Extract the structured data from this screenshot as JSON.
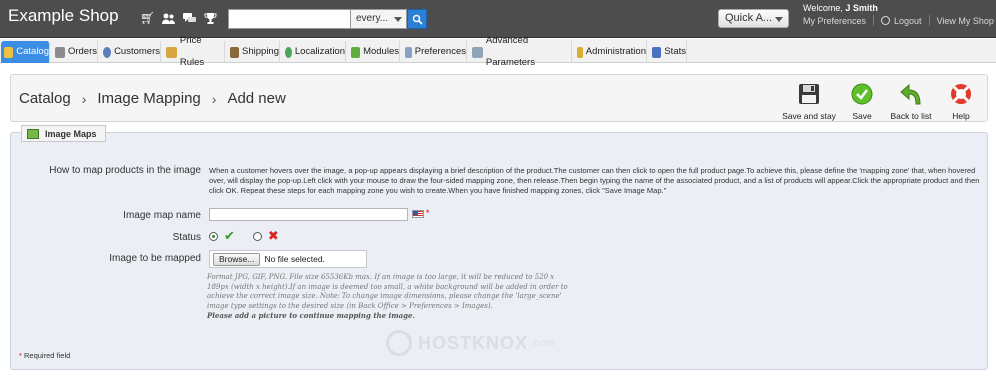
{
  "header": {
    "shop_name": "Example Shop",
    "search_placeholder": "",
    "search_scope": "every...",
    "quick_access": "Quick A...",
    "welcome_prefix": "Welcome, ",
    "user_name": "J Smith",
    "my_preferences": "My Preferences",
    "logout": "Logout",
    "view_shop": "View My Shop"
  },
  "menu": {
    "items": [
      {
        "label": "Catalog",
        "color": "#f0c040"
      },
      {
        "label": "Orders",
        "color": "#8c8c8c"
      },
      {
        "label": "Customers",
        "color": "#5b7fbd"
      },
      {
        "label": "Price Rules",
        "color": "#d8a640"
      },
      {
        "label": "Shipping",
        "color": "#8a6a3a"
      },
      {
        "label": "Localization",
        "color": "#4aa35a"
      },
      {
        "label": "Modules",
        "color": "#5fae3f"
      },
      {
        "label": "Preferences",
        "color": "#8aa0c0"
      },
      {
        "label": "Advanced Parameters",
        "color": "#8fa3b8"
      },
      {
        "label": "Administration",
        "color": "#d8b030"
      },
      {
        "label": "Stats",
        "color": "#4a70c0"
      }
    ]
  },
  "toolbar": {
    "breadcrumb": [
      "Catalog",
      "Image Mapping",
      "Add new"
    ],
    "separator": "›",
    "save_and_stay": "Save and stay",
    "save": "Save",
    "back_to_list": "Back to list",
    "help": "Help"
  },
  "panel": {
    "legend": "Image Maps",
    "howto_label": "How to map products in the image",
    "howto_text": "When a customer hovers over the image, a pop-up appears displaying a brief description of the product.The customer can then click to open the full product page.To achieve this, please define the 'mapping zone' that, when hovered over, will display the pop-up.Left click with your mouse to draw the four-sided mapping zone, then release.Then begin typing the name of the associated product, and a list of products will appear.Click the appropriate product and then click OK. Repeat these steps for each mapping zone you wish to create.When you have finished mapping zones, click \"Save Image Map.\"",
    "name_label": "Image map name",
    "name_value": "",
    "required_star": "*",
    "status_label": "Status",
    "image_label": "Image to be mapped",
    "browse": "Browse...",
    "file_status": "No file selected.",
    "help_text": "Format JPG, GIF, PNG. File size 65536Kb max. If an image is too large, it will be reduced to 520 x 189px (width x height).If an image is deemed too small, a white background will be added in order to achieve the correct image size. Note: To change image dimensions, please change the 'large_scene' image type settings to the desired size (in Back Office > Preferences > Images).",
    "help_strong": "Please add a picture to continue mapping the image.",
    "required_note_star": "*",
    "required_note": " Required field"
  },
  "watermark": {
    "text": "HOSTKNOX",
    "suffix": ".com"
  }
}
